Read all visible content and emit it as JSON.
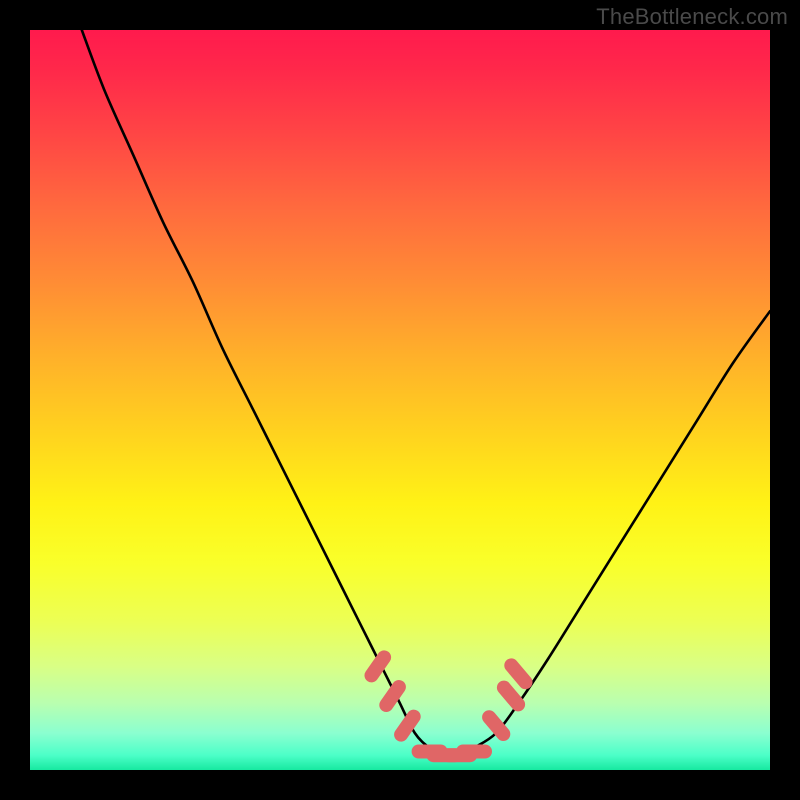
{
  "watermark": "TheBottleneck.com",
  "colors": {
    "frame": "#000000",
    "curve": "#000000",
    "marker_fill": "#e06666",
    "marker_stroke": "#c94f4f",
    "gradient_top": "#ff1a4d",
    "gradient_bottom": "#17e9a0"
  },
  "chart_data": {
    "type": "line",
    "title": "",
    "xlabel": "",
    "ylabel": "",
    "xlim": [
      0,
      100
    ],
    "ylim": [
      0,
      100
    ],
    "grid": false,
    "legend": false,
    "series": [
      {
        "name": "bottleneck-curve",
        "x": [
          7,
          10,
          14,
          18,
          22,
          26,
          30,
          34,
          38,
          42,
          45,
          48,
          50,
          52,
          54,
          56,
          58,
          60,
          63,
          66,
          70,
          75,
          80,
          85,
          90,
          95,
          100
        ],
        "y": [
          100,
          92,
          83,
          74,
          66,
          57,
          49,
          41,
          33,
          25,
          19,
          13,
          9,
          5,
          3,
          2,
          2,
          3,
          5,
          9,
          15,
          23,
          31,
          39,
          47,
          55,
          62
        ]
      }
    ],
    "markers": [
      {
        "x": 47,
        "y": 14
      },
      {
        "x": 49,
        "y": 10
      },
      {
        "x": 51,
        "y": 6
      },
      {
        "x": 54,
        "y": 2.5
      },
      {
        "x": 56,
        "y": 2
      },
      {
        "x": 58,
        "y": 2
      },
      {
        "x": 60,
        "y": 2.5
      },
      {
        "x": 63,
        "y": 6
      },
      {
        "x": 65,
        "y": 10
      },
      {
        "x": 66,
        "y": 13
      }
    ]
  }
}
